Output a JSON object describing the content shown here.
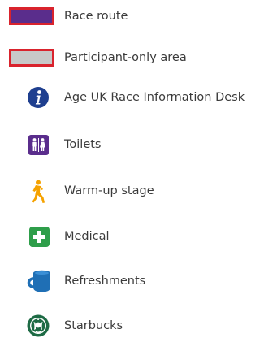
{
  "legend": {
    "items": [
      {
        "label": "Race route",
        "symbol": "race-route-swatch",
        "fill": "#5a2d8c",
        "border": "#d9232d"
      },
      {
        "label": "Participant-only area",
        "symbol": "participant-area-swatch",
        "fill": "#c8c8c8",
        "border": "#d9232d"
      },
      {
        "label": "Age UK Race Information Desk",
        "symbol": "info-icon",
        "color": "#1f3f8f"
      },
      {
        "label": "Toilets",
        "symbol": "toilets-icon",
        "color": "#5a2d8c"
      },
      {
        "label": "Warm-up stage",
        "symbol": "warm-up-figure-icon",
        "color": "#f5a200"
      },
      {
        "label": "Medical",
        "symbol": "medical-cross-icon",
        "color": "#2e9e4a"
      },
      {
        "label": "Refreshments",
        "symbol": "cup-icon",
        "color": "#1f6fb5"
      },
      {
        "label": "Starbucks",
        "symbol": "starbucks-logo-icon",
        "color": "#1e6b45"
      }
    ]
  }
}
